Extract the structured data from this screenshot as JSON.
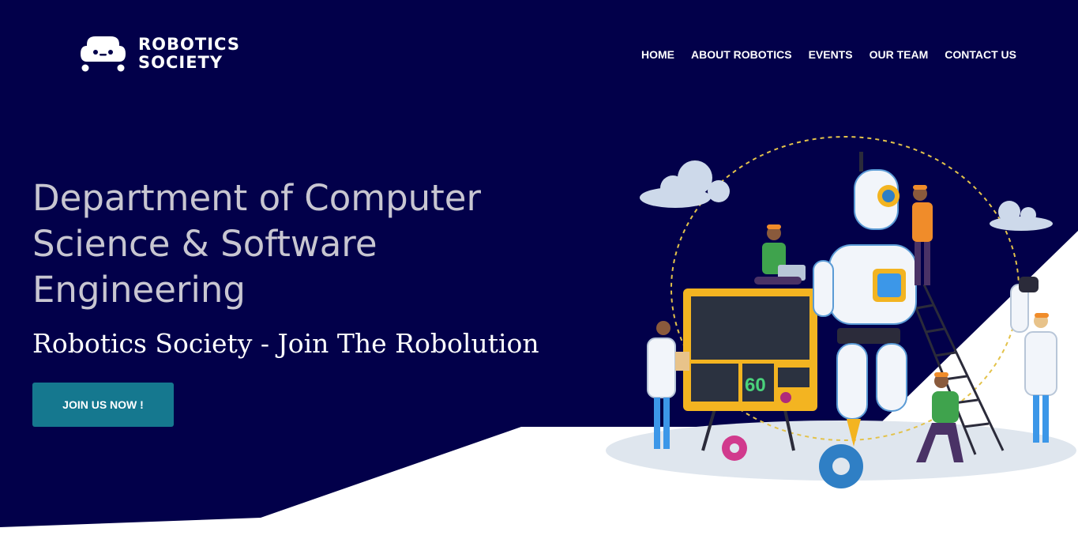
{
  "brand": {
    "line1": "ROBOTICS",
    "line2": "SOCIETY",
    "icon": "robot-head-icon"
  },
  "nav": {
    "items": [
      {
        "label": "HOME"
      },
      {
        "label": "ABOUT ROBOTICS"
      },
      {
        "label": "EVENTS"
      },
      {
        "label": "OUR TEAM"
      },
      {
        "label": "CONTACT US"
      }
    ]
  },
  "hero": {
    "title": "Department of Computer Science & Software Engineering",
    "subtitle": "Robotics Society - Join The Robolution",
    "cta_label": "JOIN US NOW !"
  },
  "illustration": {
    "monitor_value": "60"
  },
  "colors": {
    "background": "#02004a",
    "accent": "#15788f",
    "title_text": "#c8c6d1",
    "white": "#ffffff"
  }
}
